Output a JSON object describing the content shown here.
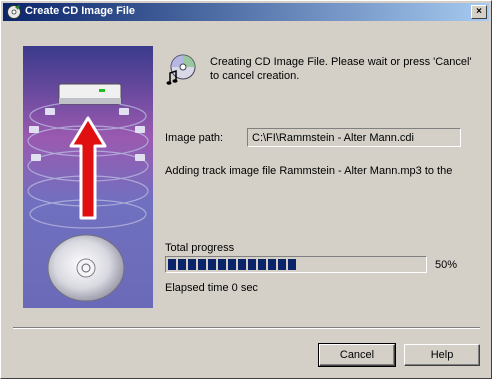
{
  "window": {
    "title": "Create CD Image File",
    "close_label": "×"
  },
  "message": "Creating CD Image File. Please wait or press 'Cancel' to cancel creation.",
  "image_path": {
    "label": "Image path:",
    "value": "C:\\FI\\Rammstein - Alter Mann.cdi"
  },
  "status": "Adding track image file Rammstein - Alter Mann.mp3 to the",
  "progress": {
    "label": "Total progress",
    "fraction": 0.5,
    "percent_text": "50%"
  },
  "elapsed": "Elapsed time 0 sec",
  "buttons": {
    "cancel": "Cancel",
    "help": "Help"
  },
  "icons": {
    "title": "cd-burn-icon",
    "message": "cd-music-icon",
    "close": "close-icon"
  }
}
